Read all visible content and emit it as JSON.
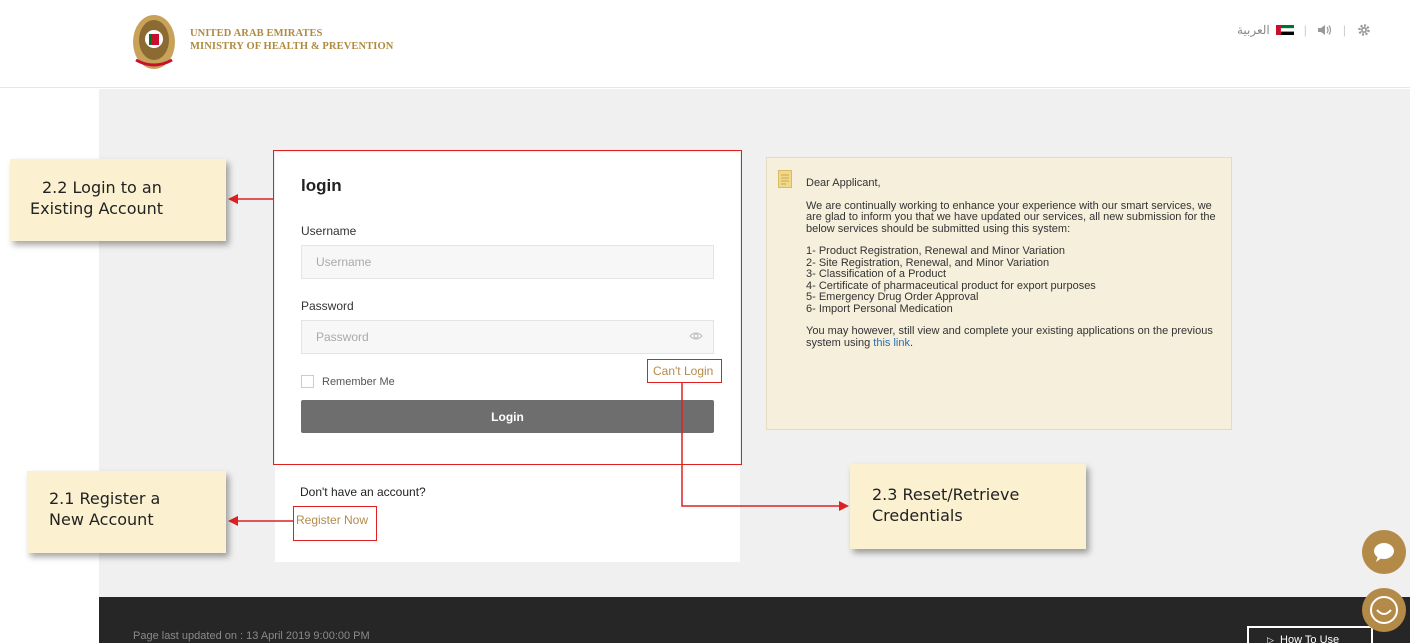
{
  "header": {
    "org_line1": "UNITED ARAB EMIRATES",
    "org_line2": "MINISTRY OF HEALTH & PREVENTION",
    "language_label": "العربية"
  },
  "login": {
    "title": "login",
    "username_label": "Username",
    "username_placeholder": "Username",
    "password_label": "Password",
    "password_placeholder": "Password",
    "remember_label": "Remember Me",
    "cant_login_label": "Can't Login",
    "login_button": "Login",
    "no_account_text": "Don't have an account?",
    "register_label": "Register Now"
  },
  "notice": {
    "greeting": "Dear Applicant,",
    "intro": "We are continually working to enhance your experience with our smart services, we are glad to inform you that we have updated our services, all new submission for the below services should be submitted using this system:",
    "items": [
      "1- Product Registration, Renewal and Minor Variation",
      "2- Site Registration, Renewal, and Minor Variation",
      "3- Classification of a Product",
      "4- Certificate of pharmaceutical product for export purposes",
      "5- Emergency Drug Order Approval",
      "6- Import Personal Medication"
    ],
    "outro": "You may however, still view and complete your existing applications on the previous system using",
    "link_text": "this link",
    "outro_end": "."
  },
  "annotations": {
    "login_existing_line1": "2.2 Login to an",
    "login_existing_line2": "Existing Account",
    "register_line1": "2.1 Register a",
    "register_line2": "New Account",
    "reset_line1": "2.3 Reset/Retrieve",
    "reset_line2": "Credentials"
  },
  "footer": {
    "updated_text": "Page last updated on : 13 April 2019 9:00:00 PM",
    "how_to_use": "How To Use"
  },
  "colors": {
    "gold": "#b38b4a",
    "annotation_red": "#e02020",
    "annotation_bg": "#fbf1d1",
    "login_button": "#6e6e6e",
    "notice_bg": "#f5efdc",
    "footer_bg": "#262626"
  }
}
